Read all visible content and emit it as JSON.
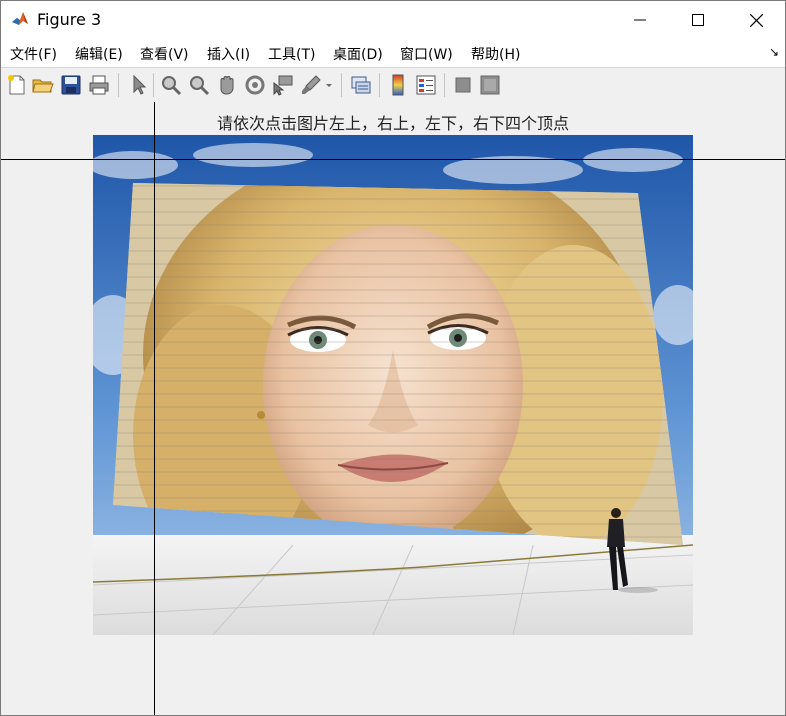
{
  "window": {
    "title": "Figure 3"
  },
  "menu": {
    "items": [
      {
        "label": "文件(F)"
      },
      {
        "label": "编辑(E)"
      },
      {
        "label": "查看(V)"
      },
      {
        "label": "插入(I)"
      },
      {
        "label": "工具(T)"
      },
      {
        "label": "桌面(D)"
      },
      {
        "label": "窗口(W)"
      },
      {
        "label": "帮助(H)"
      }
    ],
    "overflow_arrow": "↘"
  },
  "toolbar": {
    "buttons": [
      "new-figure-icon",
      "open-file-icon",
      "save-icon",
      "print-icon",
      "edit-plot-icon",
      "zoom-in-icon",
      "zoom-out-icon",
      "pan-icon",
      "rotate-3d-icon",
      "data-cursor-icon",
      "brush-icon",
      "link-plot-icon",
      "insert-colorbar-icon",
      "insert-legend-icon",
      "hide-plot-tools-icon",
      "show-plot-tools-icon"
    ]
  },
  "figure": {
    "title": "请依次点击图片左上，右上，左下，右下四个顶点"
  },
  "colors": {
    "sky_top": "#1f56a8",
    "sky_bottom": "#7fb0e0",
    "crosshair": "#000000",
    "background": "#f0f0f0"
  }
}
